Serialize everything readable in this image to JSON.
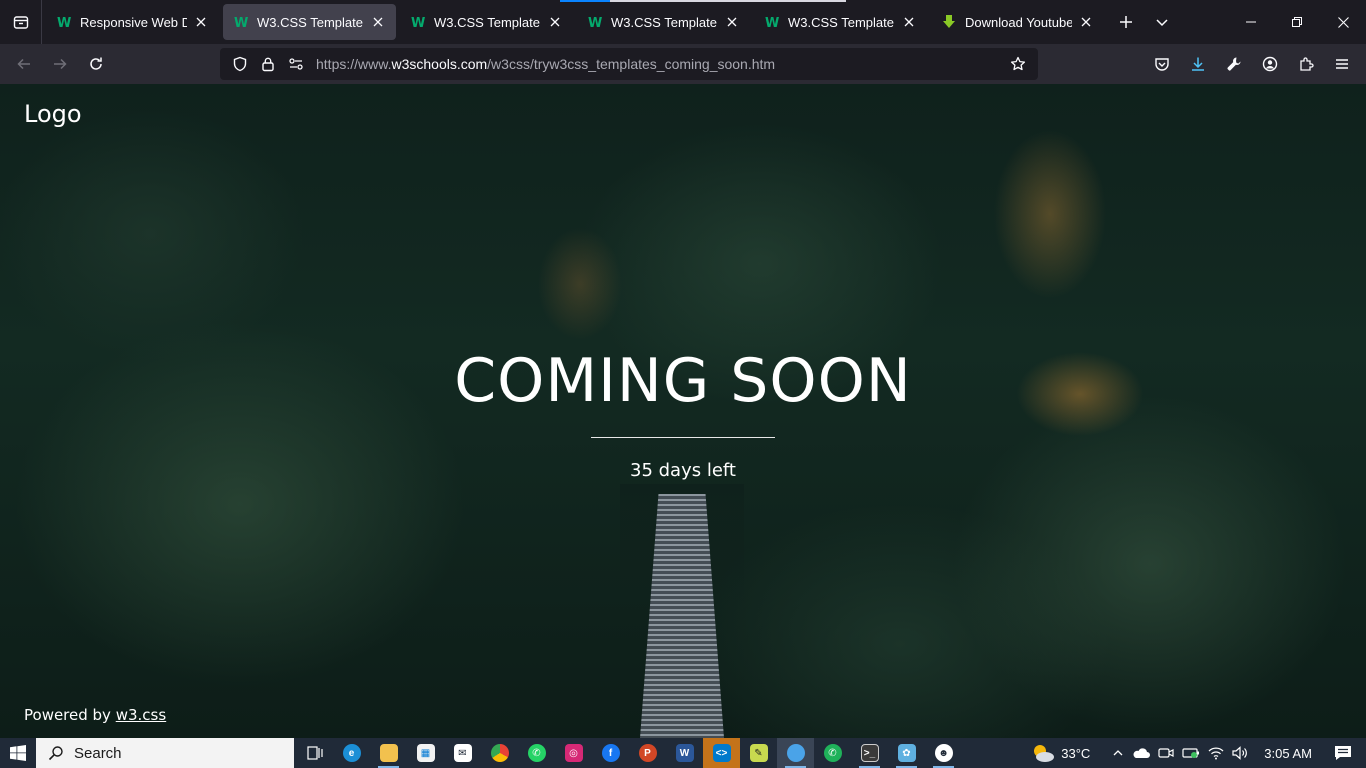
{
  "browser": {
    "tabs": [
      {
        "title": "Responsive Web Desig",
        "active": false,
        "favicon": "w3schools-icon"
      },
      {
        "title": "W3.CSS Template",
        "active": true,
        "favicon": "w3schools-icon"
      },
      {
        "title": "W3.CSS Template",
        "active": false,
        "favicon": "w3schools-icon"
      },
      {
        "title": "W3.CSS Template",
        "active": false,
        "favicon": "w3schools-icon"
      },
      {
        "title": "W3.CSS Template",
        "active": false,
        "favicon": "w3schools-icon"
      },
      {
        "title": "Download Youtube Vic",
        "active": false,
        "favicon": "download-arrow-icon"
      }
    ],
    "url": {
      "prefix": "https://www.",
      "domain": "w3schools.com",
      "path": "/w3css/tryw3css_templates_coming_soon.htm"
    }
  },
  "page": {
    "logo": "Logo",
    "title": "COMING SOON",
    "subtitle": "35 days left",
    "footer_prefix": "Powered by ",
    "footer_link": "w3.css"
  },
  "taskbar": {
    "search_label": "Search",
    "weather_temp": "33°C",
    "clock": "3:05 AM",
    "apps": [
      {
        "name": "task-view-icon",
        "color": "#202a38"
      },
      {
        "name": "edge-icon",
        "color": "#1b8fd6"
      },
      {
        "name": "file-explorer-icon",
        "color": "#f2c14e"
      },
      {
        "name": "store-icon",
        "color": "#f2f2f2"
      },
      {
        "name": "mail-icon",
        "color": "#ffffff"
      },
      {
        "name": "chrome-icon",
        "color": "#e94235"
      },
      {
        "name": "whatsapp-icon",
        "color": "#25d366"
      },
      {
        "name": "instagram-icon",
        "color": "#d62976"
      },
      {
        "name": "facebook-icon",
        "color": "#1877f2"
      },
      {
        "name": "powerpoint-icon",
        "color": "#d24726"
      },
      {
        "name": "word-icon",
        "color": "#2b579a"
      },
      {
        "name": "vscode-icon",
        "color": "#007acc"
      },
      {
        "name": "notepad-icon",
        "color": "#c8d94f"
      },
      {
        "name": "firefox-icon",
        "color": "#4aa3e8"
      },
      {
        "name": "phone-link-icon",
        "color": "#1fb25a"
      },
      {
        "name": "terminal-icon",
        "color": "#3a3a3a"
      },
      {
        "name": "paint-icon",
        "color": "#5fb0e0"
      },
      {
        "name": "game-icon",
        "color": "#ffffff"
      }
    ]
  },
  "colors": {
    "tab_strip": "#1c1b22",
    "navbar": "#2b2a33",
    "active_tab": "#42414d",
    "taskbar": "#202a38",
    "accent": "#0a84ff"
  }
}
